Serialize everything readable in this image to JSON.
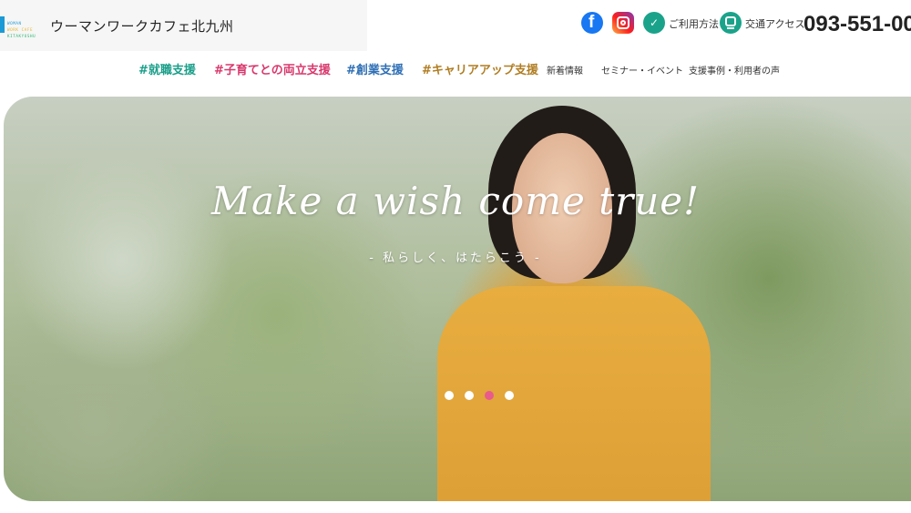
{
  "header": {
    "logo_lines": [
      "WOMAN",
      "WORK CAFE",
      "KITAKYUSHU"
    ],
    "title": "ウーマンワークカフェ北九州",
    "guide_label": "ご利用方法",
    "access_label": "交通アクセス",
    "phone": "093-551-00"
  },
  "nav": {
    "items": [
      {
        "label": "#就職支援",
        "color": "#1a9f8a"
      },
      {
        "label": "#子育てとの両立支援",
        "color": "#d9386d"
      },
      {
        "label": "#創業支援",
        "color": "#2f6fb5"
      },
      {
        "label": "#キャリアアップ支援",
        "color": "#b07d22"
      }
    ],
    "links": [
      "新着情報",
      "セミナー・イベント",
      "支援事例・利用者の声"
    ]
  },
  "hero": {
    "tagline": "Make a wish come true!",
    "subtagline": "- 私らしく、はたらこう -",
    "slides": 4,
    "active_slide": 3,
    "accent": "#e85b8c"
  },
  "icons": {
    "facebook": "facebook-icon",
    "instagram": "instagram-icon",
    "guide": "guide-icon",
    "train": "train-icon"
  }
}
